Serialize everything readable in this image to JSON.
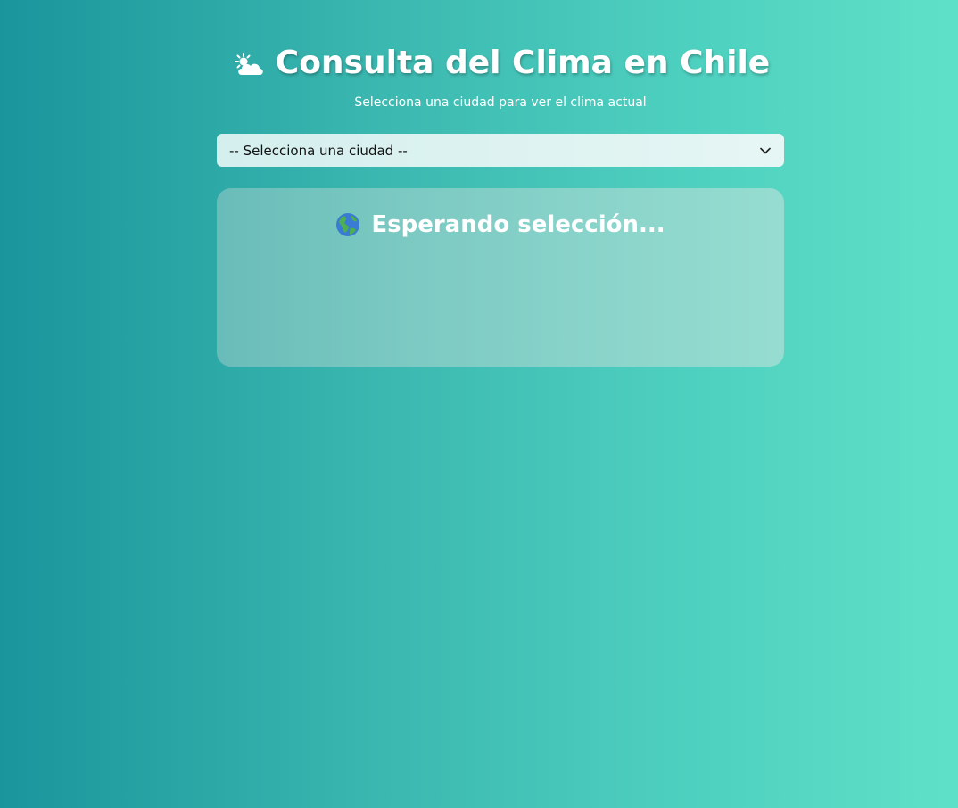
{
  "header": {
    "title": "Consulta del Clima en Chile",
    "title_icon": "sun-behind-cloud-icon",
    "subtitle": "Selecciona una ciudad para ver el clima actual"
  },
  "city_select": {
    "selected_value": "-- Selecciona una ciudad --",
    "icon": "chevron-down-icon"
  },
  "status": {
    "icon": "globe-americas-icon",
    "text": "Esperando selección..."
  },
  "colors": {
    "background_start": "#1a959c",
    "background_end": "#5ee0c8",
    "text": "#ffffff"
  }
}
